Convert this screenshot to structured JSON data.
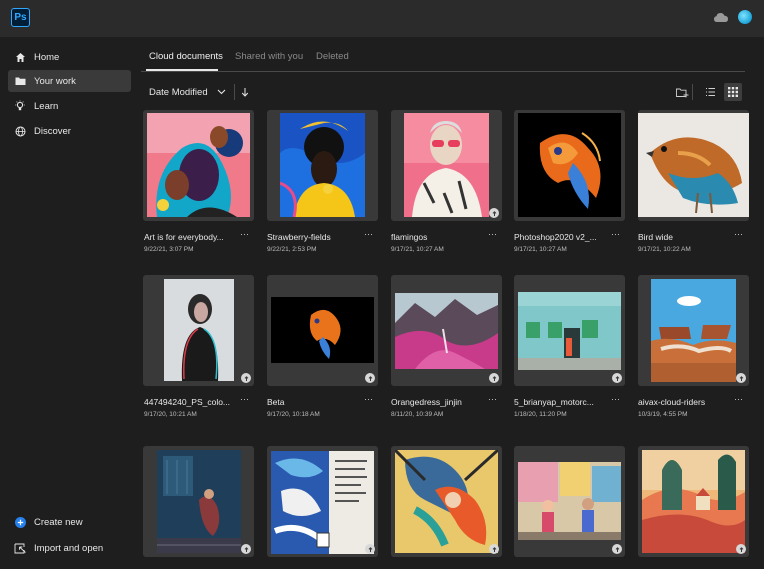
{
  "app": {
    "logo_text": "Ps"
  },
  "sidebar": {
    "items": [
      {
        "label": "Home",
        "icon": "home-icon"
      },
      {
        "label": "Your work",
        "icon": "folder-icon"
      },
      {
        "label": "Learn",
        "icon": "lightbulb-icon"
      },
      {
        "label": "Discover",
        "icon": "globe-icon"
      }
    ],
    "bottom": [
      {
        "label": "Create new",
        "icon": "plus-circle-icon"
      },
      {
        "label": "Import and open",
        "icon": "import-icon"
      }
    ]
  },
  "tabs": [
    {
      "label": "Cloud documents",
      "active": true
    },
    {
      "label": "Shared with you",
      "active": false
    },
    {
      "label": "Deleted",
      "active": false
    }
  ],
  "sort": {
    "label": "Date Modified"
  },
  "colors": {
    "accent": "#31a8ff",
    "card_bg": "#393939",
    "create_new": "#2680eb"
  },
  "files": [
    {
      "name": "Art is for everybody...",
      "date": "9/22/21, 3:07 PM",
      "more": "···"
    },
    {
      "name": "Strawberry-fields",
      "date": "9/22/21, 2:53 PM",
      "more": "···"
    },
    {
      "name": "flamingos",
      "date": "9/17/21, 10:27 AM",
      "more": "···"
    },
    {
      "name": "Photoshop2020 v2_...",
      "date": "9/17/21, 10:27 AM",
      "more": "···"
    },
    {
      "name": "Bird wide",
      "date": "9/17/21, 10:22 AM",
      "more": "···"
    },
    {
      "name": "447494240_PS_colo...",
      "date": "9/17/20, 10:21 AM",
      "more": "···"
    },
    {
      "name": "Beta",
      "date": "9/17/20, 10:18 AM",
      "more": "···"
    },
    {
      "name": "Orangedress_jinjin",
      "date": "8/11/20, 10:39 AM",
      "more": "···"
    },
    {
      "name": "5_brianyap_motorc...",
      "date": "1/18/20, 11:20 PM",
      "more": "···"
    },
    {
      "name": "aivax-cloud-riders",
      "date": "10/3/19, 4:55 PM",
      "more": "···"
    },
    {
      "name": "",
      "date": ""
    },
    {
      "name": "",
      "date": ""
    },
    {
      "name": "",
      "date": ""
    },
    {
      "name": "",
      "date": ""
    },
    {
      "name": "",
      "date": ""
    }
  ]
}
